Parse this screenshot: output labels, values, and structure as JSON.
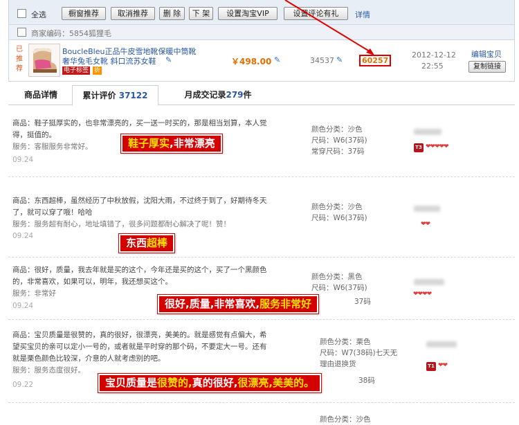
{
  "toolbar": {
    "select_all": "全选",
    "buttons": [
      "橱窗推荐",
      "取消推荐",
      "删 除",
      "下 架",
      "设置淘宝VIP",
      "设置评论有礼"
    ],
    "detail_link": "详情"
  },
  "merchant_code": "商家编码：5854狐狸毛",
  "product": {
    "rec_tag": [
      "已",
      "推",
      "荐"
    ],
    "title_line1": "BoucleBleu正品牛皮雪地靴保暖中筒靴",
    "title_line2": "奢华兔毛女靴 斜口流苏女鞋",
    "badge_e": "电子标签",
    "badge_zhe": "折",
    "price": "￥498.00",
    "stock": "34537",
    "sales": "60257",
    "date": "2012-12-12",
    "time": "22:55",
    "edit": "编辑宝贝",
    "copy": "复制链接"
  },
  "tabs": [
    {
      "label": "商品详情",
      "count": ""
    },
    {
      "label": "累计评价",
      "count": "37122"
    },
    {
      "label": "月成交记录",
      "count": "279",
      "suffix": "件"
    }
  ],
  "reviews": [
    {
      "line1": "商品：鞋子挺厚实的，也非常漂亮的，买一送一时买的，那是相当划算，本人觉",
      "line2": "得，挺值的。",
      "line3": "服务：客服服务非常好。",
      "date": "09.24",
      "meta1": "颜色分类：沙色",
      "meta2": "尺码：W6(37码)",
      "meta3": "常穿尺码：37码",
      "level": "T3",
      "hearts": "❤❤❤❤❤",
      "banner_a": "鞋子厚实",
      "banner_b": ",非常漂亮"
    },
    {
      "line1": "商品：东西超棒，虽然经历了中秋放假，沈阳大雨，不过终于到了，好期待冬天",
      "line2": "了，就可以穿了哦！哈哈",
      "line3": "服务：服务超有耐心，地址填错了，很多问题都耐心解决了呢！赞！",
      "date": "09.24",
      "meta1": "颜色分类：沙色",
      "meta2": "尺码：W6(37码)",
      "hearts": "❤❤",
      "banner_a": "东西",
      "banner_b": "超棒"
    },
    {
      "line1": "商品：很好，质量，我去年就是买的这个，今年还是买的这个，买了一个黑颜色",
      "line2": "的，非常喜欢，如果可以，明年，我还想买这个。",
      "line3": "服务：非常好",
      "date": "09.24",
      "meta1": "颜色分类：黑色",
      "meta2": "尺码：W6(37码)",
      "meta3": "37码",
      "hearts": "❤❤❤❤",
      "banner_a": "很好,质量,非常喜欢,",
      "banner_b": "服务非常好"
    },
    {
      "line1": "商品：宝贝质量是很赞的，真的很好，很漂亮，美美的。就是感觉有点偏大，希",
      "line2": "望买宝贝的亲可以定小一号的，或者就是平时穿的那个码，不要定大一号。还有",
      "line3": "就是栗色颜色比较深，介意的人就考虑别的吧。",
      "line4": "服务：服务态度很好。",
      "date": "09.22",
      "meta1": "颜色分类：栗色",
      "meta2": "尺码：W7(38码)七天无",
      "meta3": "理由退换货",
      "meta4": "38码",
      "level": "T1",
      "hearts": "❤❤",
      "banner_a": "宝贝质量是",
      "banner_b": "很赞的,",
      "banner_c": "真的很好,",
      "banner_d": "很漂亮,美美的。"
    },
    {
      "meta1": "颜色分类：沙色"
    }
  ],
  "colors": {
    "accent_red": "#d40000",
    "link_blue": "#2957a4",
    "price_orange": "#e07000"
  }
}
